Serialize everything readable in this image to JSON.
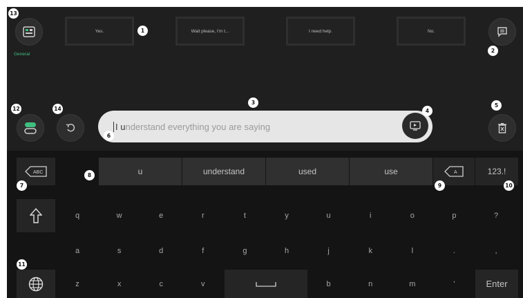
{
  "phrases": [
    "Yes.",
    "Wait please, I'm t...",
    "I need help.",
    "No."
  ],
  "category_label": "General",
  "text_input": {
    "typed": "I u",
    "suggestion_rest": "nderstand everything you are saying"
  },
  "suggestions": [
    "u",
    "understand",
    "used",
    "use"
  ],
  "keys": {
    "abc": "ABC",
    "backspace_letter": "A",
    "numbers": "123.!",
    "row1": [
      "q",
      "w",
      "e",
      "r",
      "t",
      "y",
      "u",
      "i",
      "o",
      "p",
      "?"
    ],
    "row2": [
      "a",
      "s",
      "d",
      "f",
      "g",
      "h",
      "j",
      "k",
      "l",
      ".",
      ","
    ],
    "row3_left": [
      "z",
      "x",
      "c",
      "v"
    ],
    "row3_right": [
      "b",
      "n",
      "m",
      "'"
    ],
    "enter": "Enter"
  },
  "badges": [
    "1",
    "2",
    "3",
    "4",
    "5",
    "6",
    "7",
    "8",
    "9",
    "10",
    "11",
    "12",
    "13",
    "14"
  ],
  "colors": {
    "background": "#1f1f1f",
    "keyboard": "#141414",
    "accent": "#3fbf7f",
    "input": "#e6e6e6"
  }
}
